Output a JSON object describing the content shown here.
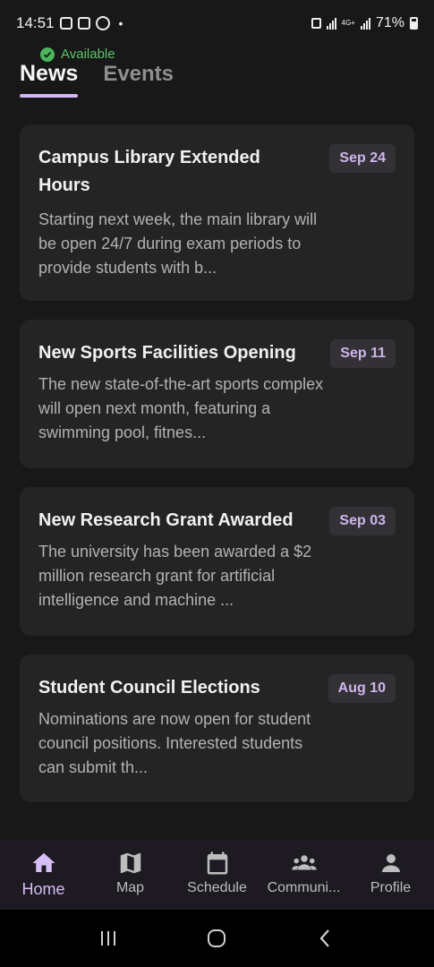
{
  "status_bar": {
    "time": "14:51",
    "battery": "71%",
    "network": "4G+"
  },
  "availability": {
    "label": "Available",
    "color": "#5cc36b"
  },
  "tabs": [
    {
      "label": "News",
      "active": true
    },
    {
      "label": "Events",
      "active": false
    }
  ],
  "news": [
    {
      "title": "Campus Library Extended Hours",
      "date": "Sep 24",
      "body": "Starting next week, the main library will be open 24/7 during exam periods to provide students with b..."
    },
    {
      "title": "New Sports Facilities Opening",
      "date": "Sep 11",
      "body": "The new state-of-the-art sports complex will open next month, featuring a swimming pool, fitnes..."
    },
    {
      "title": "New Research Grant Awarded",
      "date": "Sep 03",
      "body": "The university has been awarded a $2 million research grant for artificial intelligence and machine ..."
    },
    {
      "title": "Student Council Elections",
      "date": "Aug 10",
      "body": "Nominations are now open for student council positions. Interested students can submit th..."
    }
  ],
  "bottom_nav": [
    {
      "label": "Home",
      "icon": "home-icon",
      "active": true
    },
    {
      "label": "Map",
      "icon": "map-icon",
      "active": false
    },
    {
      "label": "Schedule",
      "icon": "calendar-icon",
      "active": false
    },
    {
      "label": "Communi...",
      "icon": "community-icon",
      "active": false
    },
    {
      "label": "Profile",
      "icon": "profile-icon",
      "active": false
    }
  ],
  "colors": {
    "accent": "#d4b6f4",
    "background": "#181818",
    "card": "#242424",
    "date_chip": "#333136"
  }
}
